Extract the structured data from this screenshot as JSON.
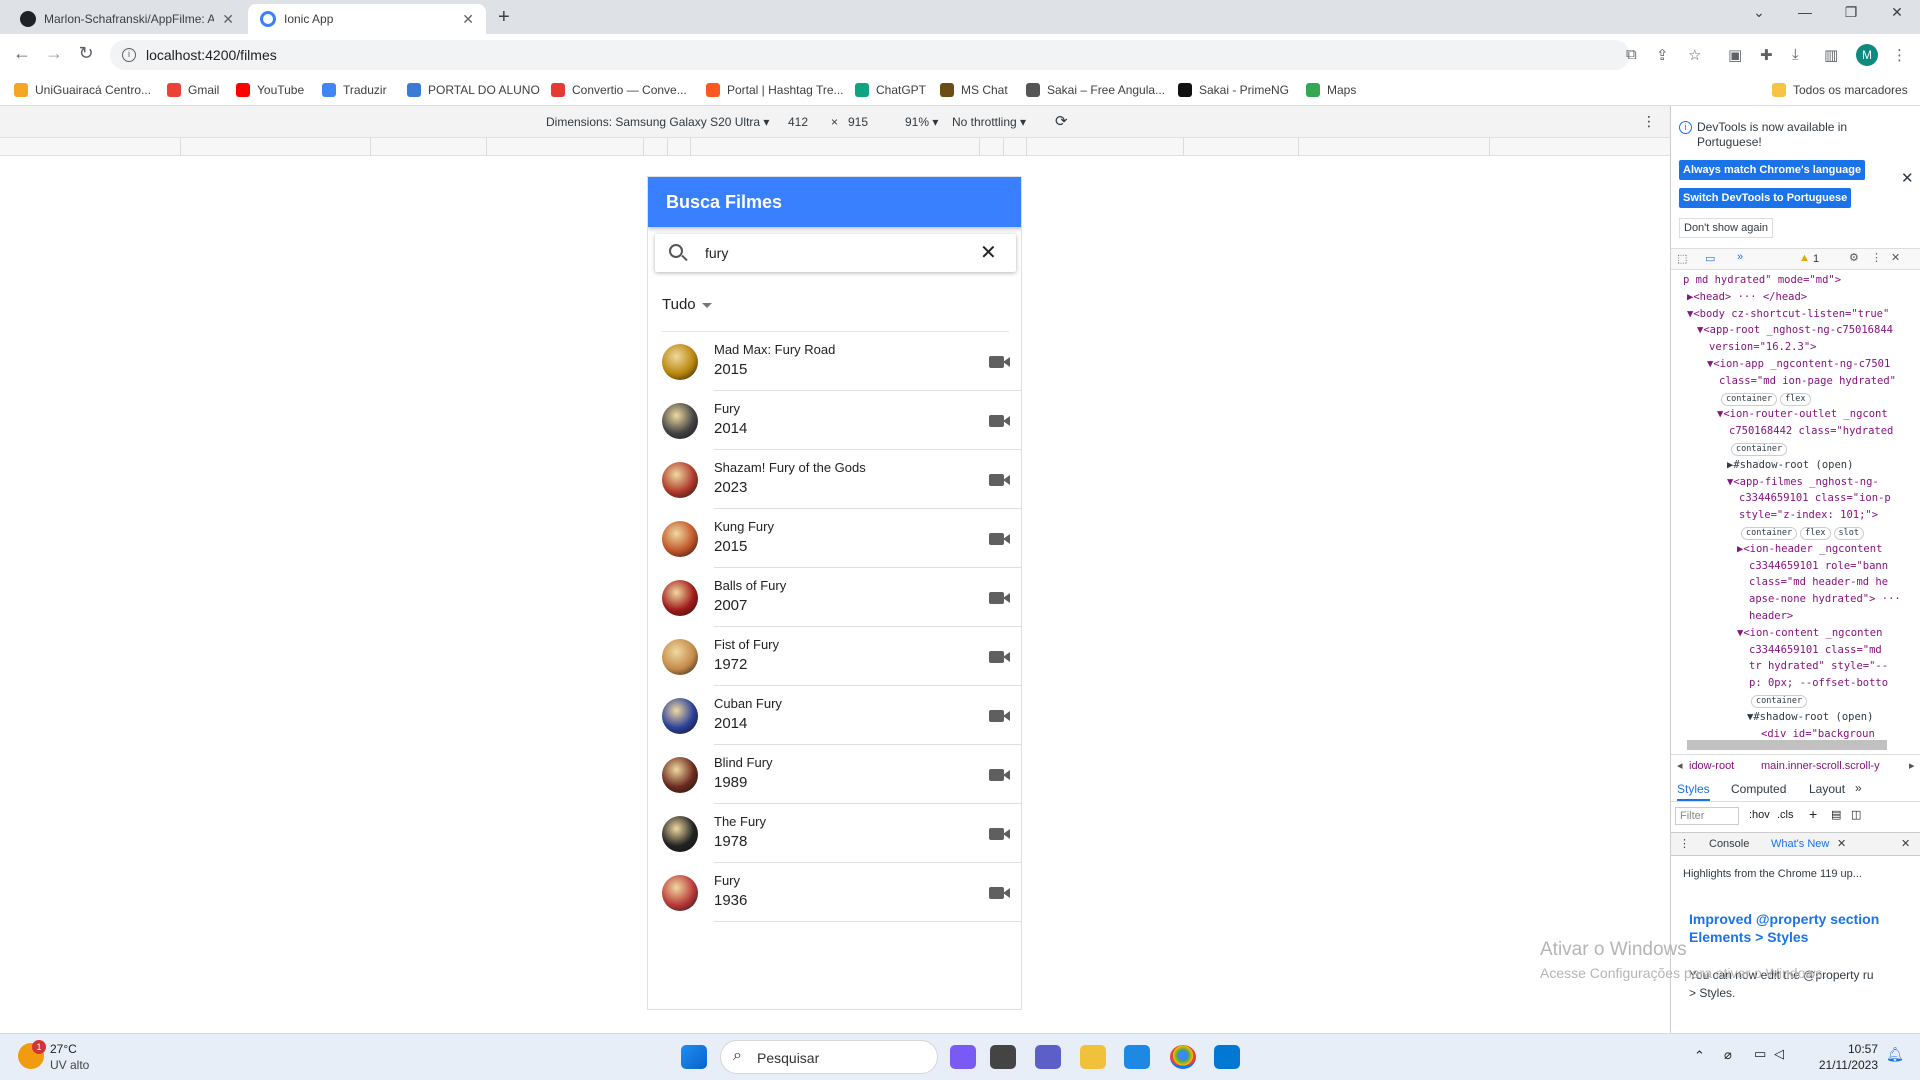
{
  "browser": {
    "tabs": [
      {
        "title": "Marlon-Schafranski/AppFilme: A",
        "favicon": "github-icon",
        "active": false
      },
      {
        "title": "Ionic App",
        "favicon": "ionic-icon",
        "active": true
      }
    ],
    "url": "localhost:4200/filmes",
    "profile_initial": "M",
    "bookmarks": [
      {
        "label": "UniGuairacá Centro...",
        "color": "#f5a623"
      },
      {
        "label": "Gmail",
        "color": "#ea4335"
      },
      {
        "label": "YouTube",
        "color": "#ff0000"
      },
      {
        "label": "Traduzir",
        "color": "#4285f4"
      },
      {
        "label": "PORTAL DO ALUNO",
        "color": "#3a7bd5"
      },
      {
        "label": "Convertio — Conve...",
        "color": "#e53935"
      },
      {
        "label": "Portal | Hashtag Tre...",
        "color": "#ff5722"
      },
      {
        "label": "ChatGPT",
        "color": "#10a37f"
      },
      {
        "label": "MS Chat",
        "color": "#6b4e16"
      },
      {
        "label": "Sakai – Free Angula...",
        "color": "#555555"
      },
      {
        "label": "Sakai - PrimeNG",
        "color": "#111111"
      },
      {
        "label": "Maps",
        "color": "#34a853"
      }
    ],
    "all_bookmarks": "Todos os marcadores"
  },
  "device_toolbar": {
    "dimensions": "Dimensions: Samsung Galaxy S20 Ultra",
    "width": "412",
    "times": "×",
    "height": "915",
    "zoom": "91%",
    "throttling": "No throttling"
  },
  "app": {
    "title": "Busca Filmes",
    "search_value": "fury",
    "filter": "Tudo",
    "movies": [
      {
        "title": "Mad Max: Fury Road",
        "year": "2015",
        "color": "#b8860b"
      },
      {
        "title": "Fury",
        "year": "2014",
        "color": "#444444"
      },
      {
        "title": "Shazam! Fury of the Gods",
        "year": "2023",
        "color": "#b0392c"
      },
      {
        "title": "Kung Fury",
        "year": "2015",
        "color": "#c0562a"
      },
      {
        "title": "Balls of Fury",
        "year": "2007",
        "color": "#a11b1b"
      },
      {
        "title": "Fist of Fury",
        "year": "1972",
        "color": "#c58a4a"
      },
      {
        "title": "Cuban Fury",
        "year": "2014",
        "color": "#2a3f99"
      },
      {
        "title": "Blind Fury",
        "year": "1989",
        "color": "#6b2a1e"
      },
      {
        "title": "The Fury",
        "year": "1978",
        "color": "#222222"
      },
      {
        "title": "Fury",
        "year": "1936",
        "color": "#b93a3a"
      }
    ]
  },
  "devtools": {
    "notice": "DevTools is now available in Portuguese!",
    "btn_match": "Always match Chrome's language",
    "btn_switch": "Switch DevTools to Portuguese",
    "btn_dont": "Don't show again",
    "warning_count": "1",
    "dom_lines": [
      "p md hydrated\" mode=\"md\">",
      "▶<head> ··· </head>",
      "▼<body cz-shortcut-listen=\"true\"",
      "▼<app-root _nghost-ng-c75016844",
      "version=\"16.2.3\">",
      "▼<ion-app _ngcontent-ng-c7501",
      "class=\"md ion-page hydrated\"",
      "container  flex",
      "▼<ion-router-outlet _ngcont",
      "c750168442 class=\"hydrated",
      "container",
      "▶#shadow-root (open)",
      "▼<app-filmes _nghost-ng-",
      "c3344659101 class=\"ion-p",
      "style=\"z-index: 101;\">",
      "container  flex  slot",
      "▶<ion-header _ngcontent",
      "c3344659101 role=\"bann",
      "class=\"md header-md he",
      "apse-none hydrated\"> ···",
      "header>",
      "▼<ion-content _ngconten",
      "c3344659101 class=\"md",
      "tr hydrated\" style=\"--",
      "p: 0px; --offset-botto",
      "container",
      "▼#shadow-root (open)",
      "<div id=\"backgroun"
    ],
    "crumb1": "idow-root",
    "crumb2": "main.inner-scroll.scroll-y",
    "style_tabs": [
      "Styles",
      "Computed",
      "Layout"
    ],
    "filter_placeholder": "Filter",
    "hov": ":hov",
    "cls": ".cls",
    "console_tab": "Console",
    "whats_new_tab": "What's New",
    "highlights": "Highlights from the Chrome 119 up...",
    "whats_new_heading1": "Improved @property section",
    "whats_new_heading2": "Elements > Styles",
    "whats_new_body1": "You can now edit the @property ru",
    "whats_new_body2": "> Styles."
  },
  "watermark": {
    "line1": "Ativar o Windows",
    "line2": "Acesse Configurações para ativar o Windows."
  },
  "taskbar": {
    "temp": "27°C",
    "weather": "UV alto",
    "badge": "1",
    "search": "Pesquisar",
    "time": "10:57",
    "date": "21/11/2023"
  }
}
